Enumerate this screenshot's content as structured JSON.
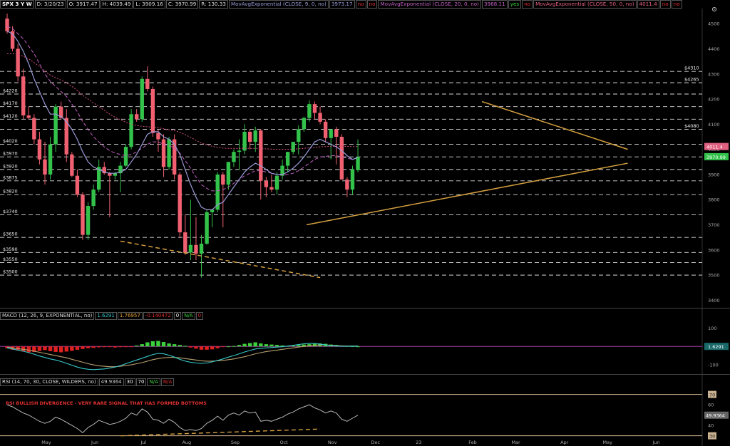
{
  "header": {
    "symbol": "SPX 3 Y W",
    "date": "D: 3/20/23",
    "open": "O: 3917.47",
    "high": "H: 4039.49",
    "low": "L: 3909.16",
    "close": "C: 3970.99",
    "range": "R: 130.33",
    "study_items": [
      {
        "label": "MovAvgExponential (CLOSE, 9, 0, no)",
        "value": "3973.17",
        "a": "no",
        "b": "no",
        "color": "#9a9ad8"
      },
      {
        "label": "MovAvgExponential (CLOSE, 20, 0, no)",
        "value": "3968.11",
        "a": "yes",
        "b": "no",
        "color": "#c060c0"
      },
      {
        "label": "MovAvgExponential (CLOSE, 50, 0, no)",
        "value": "4011.4",
        "a": "no",
        "b": "no",
        "color": "#e06080"
      }
    ]
  },
  "macd_header": {
    "label": "MACD (12, 26, 9, EXPONENTIAL, no)",
    "values": [
      "1.6291",
      "1.76957",
      "-0.140472",
      "0",
      "N/A",
      "0"
    ],
    "colors": [
      "#37c8c8",
      "#e8a838",
      "#e03030",
      "#ffffff",
      "#3cd03c",
      "#e03030"
    ]
  },
  "rsi_header": {
    "label": "RSI (14, 70, 30, CLOSE, WILDERS, no)",
    "values": [
      "49.9364",
      "30",
      "70",
      "N/A",
      "N/A"
    ],
    "colors": [
      "#cccccc",
      "#ffffff",
      "#ffffff",
      "#3cd03c",
      "#e03030"
    ]
  },
  "annotations": {
    "rsi_note": "RSI BULLISH DIVERGENCE - VERY RARE SIGNAL THAT HAS FORMED BOTTOMS"
  },
  "colors": {
    "up": "#33c24a",
    "down": "#f06070",
    "ema9": "#9a9ad8",
    "ema20": "#c060c0",
    "ema50": "#d05080",
    "trend": "#d4a040",
    "macd": "#37c8c8",
    "signal": "#b8a070"
  },
  "chart_data": [
    {
      "type": "candlestick",
      "title": "SPX 3 Y W",
      "ylim": [
        3370,
        4560
      ],
      "y_ticks": [
        3400,
        3500,
        3600,
        3700,
        3800,
        3900,
        4000,
        4100,
        4200,
        4300,
        4400,
        4500
      ],
      "x_tick_labels": [
        {
          "label": "May",
          "i": 0
        },
        {
          "label": "Jun",
          "i": 9
        },
        {
          "label": "Jul",
          "i": 18
        },
        {
          "label": "Aug",
          "i": 26
        },
        {
          "label": "Sep",
          "i": 35
        },
        {
          "label": "Oct",
          "i": 44
        },
        {
          "label": "Nov",
          "i": 53
        },
        {
          "label": "Dec",
          "i": 61
        },
        {
          "label": "23",
          "i": 69
        },
        {
          "label": "Feb",
          "i": 79
        },
        {
          "label": "Mar",
          "i": 87
        },
        {
          "label": "Apr",
          "i": 96
        },
        {
          "label": "May",
          "i": 104
        },
        {
          "label": "Jun",
          "i": 113
        },
        {
          "label": "Jul",
          "i": 122
        }
      ],
      "levels": [
        {
          "label": "$4310",
          "y": 4310,
          "side": "right"
        },
        {
          "label": "$4265",
          "y": 4265,
          "side": "right"
        },
        {
          "label": "$4220",
          "y": 4220,
          "side": "left"
        },
        {
          "label": "$4170",
          "y": 4170,
          "side": "left"
        },
        {
          "label": "$4120",
          "y": 4120,
          "side": "left"
        },
        {
          "label": "$4080",
          "y": 4080,
          "side": "right"
        },
        {
          "label": "$4020",
          "y": 4020,
          "side": "left"
        },
        {
          "label": "$3970",
          "y": 3970,
          "side": "left"
        },
        {
          "label": "$3920",
          "y": 3920,
          "side": "left"
        },
        {
          "label": "$3875",
          "y": 3875,
          "side": "left"
        },
        {
          "label": "$3820",
          "y": 3820,
          "side": "left"
        },
        {
          "label": "$3740",
          "y": 3740,
          "side": "left"
        },
        {
          "label": "$3650",
          "y": 3650,
          "side": "left"
        },
        {
          "label": "$3590",
          "y": 3590,
          "side": "left"
        },
        {
          "label": "$3550",
          "y": 3550,
          "side": "left"
        },
        {
          "label": "$3500",
          "y": 3500,
          "side": "left"
        }
      ],
      "price_badges": [
        {
          "label": "4011.4",
          "y": 4011.4,
          "color": "#e06080"
        },
        {
          "label": "3970.99",
          "y": 3970.99,
          "color": "#33c24a"
        }
      ],
      "candles": [
        [
          4520,
          4540,
          4460,
          4470
        ],
        [
          4470,
          4490,
          4390,
          4400
        ],
        [
          4400,
          4420,
          4270,
          4290
        ],
        [
          4290,
          4320,
          4120,
          4135
        ],
        [
          4135,
          4170,
          4120,
          4125
        ],
        [
          4125,
          4140,
          4020,
          4040
        ],
        [
          4040,
          4070,
          3940,
          3960
        ],
        [
          3960,
          4030,
          3860,
          3900
        ],
        [
          3900,
          4050,
          3880,
          4020
        ],
        [
          4020,
          4180,
          3990,
          4170
        ],
        [
          4170,
          4190,
          4120,
          4125
        ],
        [
          4125,
          4160,
          3950,
          3980
        ],
        [
          3980,
          3990,
          3890,
          3895
        ],
        [
          3895,
          3920,
          3810,
          3820
        ],
        [
          3820,
          3830,
          3640,
          3660
        ],
        [
          3660,
          3790,
          3640,
          3775
        ],
        [
          3775,
          3860,
          3760,
          3840
        ],
        [
          3840,
          3960,
          3830,
          3930
        ],
        [
          3930,
          3950,
          3900,
          3905
        ],
        [
          3905,
          3910,
          3730,
          3895
        ],
        [
          3895,
          3910,
          3880,
          3905
        ],
        [
          3905,
          3950,
          3830,
          3935
        ],
        [
          3935,
          4020,
          3930,
          4010
        ],
        [
          4010,
          4160,
          4000,
          4140
        ],
        [
          4140,
          4160,
          4110,
          4120
        ],
        [
          4120,
          4290,
          4110,
          4280
        ],
        [
          4280,
          4330,
          4230,
          4240
        ],
        [
          4240,
          4250,
          4050,
          4065
        ],
        [
          4065,
          4080,
          3990,
          4040
        ],
        [
          4040,
          4060,
          3890,
          3930
        ],
        [
          3930,
          4050,
          3920,
          4040
        ],
        [
          4040,
          4060,
          3880,
          3900
        ],
        [
          3900,
          3910,
          3650,
          3670
        ],
        [
          3670,
          3740,
          3580,
          3590
        ],
        [
          3590,
          3800,
          3560,
          3620
        ],
        [
          3620,
          3730,
          3560,
          3585
        ],
        [
          3585,
          3660,
          3490,
          3625
        ],
        [
          3625,
          3760,
          3620,
          3750
        ],
        [
          3750,
          3760,
          3690,
          3760
        ],
        [
          3760,
          3910,
          3750,
          3900
        ],
        [
          3900,
          3910,
          3690,
          3860
        ],
        [
          3860,
          3950,
          3840,
          3950
        ],
        [
          3950,
          4000,
          3930,
          3990
        ],
        [
          3990,
          4040,
          3920,
          3995
        ],
        [
          3995,
          4100,
          3980,
          4070
        ],
        [
          4070,
          4080,
          4000,
          4030
        ],
        [
          4030,
          4090,
          3990,
          4075
        ],
        [
          4075,
          4080,
          3800,
          3875
        ],
        [
          3875,
          3890,
          3810,
          3850
        ],
        [
          3850,
          3900,
          3830,
          3840
        ],
        [
          3840,
          3910,
          3820,
          3895
        ],
        [
          3895,
          3960,
          3880,
          3935
        ],
        [
          3935,
          3990,
          3910,
          3990
        ],
        [
          3990,
          4030,
          3980,
          4030
        ],
        [
          4030,
          4095,
          3980,
          4080
        ],
        [
          4080,
          4130,
          4070,
          4125
        ],
        [
          4125,
          4195,
          4110,
          4180
        ],
        [
          4180,
          4190,
          4120,
          4145
        ],
        [
          4145,
          4170,
          4100,
          4110
        ],
        [
          4110,
          4120,
          4030,
          4045
        ],
        [
          4045,
          4060,
          3960,
          4080
        ],
        [
          4080,
          4090,
          3940,
          4050
        ],
        [
          4050,
          4060,
          3900,
          3880
        ],
        [
          3880,
          3890,
          3810,
          3840
        ],
        [
          3840,
          3935,
          3820,
          3920
        ],
        [
          3917.47,
          4039.49,
          3909.16,
          3970.99
        ]
      ],
      "ema9": [
        4470,
        4460,
        4430,
        4390,
        4340,
        4280,
        4230,
        4180,
        4140,
        4140,
        4130,
        4110,
        4080,
        4040,
        3990,
        3950,
        3930,
        3920,
        3910,
        3905,
        3905,
        3910,
        3920,
        3950,
        3980,
        4020,
        4060,
        4070,
        4070,
        4050,
        4040,
        4020,
        3980,
        3920,
        3860,
        3810,
        3770,
        3760,
        3760,
        3780,
        3790,
        3820,
        3850,
        3880,
        3910,
        3930,
        3945,
        3935,
        3920,
        3905,
        3900,
        3900,
        3910,
        3925,
        3945,
        3970,
        4000,
        4030,
        4040,
        4030,
        4020,
        4010,
        3995,
        3975,
        3960,
        3968
      ],
      "ema20": [
        4490,
        4480,
        4460,
        4440,
        4410,
        4380,
        4340,
        4300,
        4270,
        4250,
        4230,
        4210,
        4180,
        4150,
        4110,
        4080,
        4050,
        4030,
        4010,
        3995,
        3985,
        3980,
        3975,
        3980,
        3990,
        4005,
        4020,
        4030,
        4030,
        4020,
        4015,
        4005,
        3985,
        3955,
        3925,
        3890,
        3860,
        3845,
        3835,
        3835,
        3840,
        3850,
        3865,
        3880,
        3895,
        3905,
        3915,
        3915,
        3910,
        3905,
        3900,
        3898,
        3900,
        3905,
        3915,
        3930,
        3945,
        3960,
        3970,
        3972,
        3975,
        3975,
        3970,
        3965,
        3960,
        3968
      ],
      "ema50": [
        4380,
        4380,
        4378,
        4370,
        4360,
        4345,
        4330,
        4310,
        4295,
        4285,
        4275,
        4265,
        4250,
        4235,
        4215,
        4200,
        4185,
        4170,
        4155,
        4140,
        4128,
        4118,
        4108,
        4100,
        4095,
        4092,
        4090,
        4088,
        4086,
        4082,
        4078,
        4074,
        4068,
        4058,
        4048,
        4036,
        4025,
        4018,
        4012,
        4008,
        4005,
        4004,
        4004,
        4004,
        4004,
        4004,
        4004,
        4003,
        4002,
        4001,
        4000,
        4000,
        4000,
        4001,
        4002,
        4004,
        4006,
        4008,
        4010,
        4011,
        4012,
        4012,
        4012,
        4012,
        4011,
        4011.4
      ],
      "trendlines": [
        {
          "from": [
            55.5,
            3700
          ],
          "to": [
            115,
            3945
          ],
          "dash": false
        },
        {
          "from": [
            88,
            4190
          ],
          "to": [
            115,
            4000
          ],
          "dash": false
        },
        {
          "from": [
            21,
            3635
          ],
          "to": [
            58,
            3490
          ],
          "dash": true
        }
      ]
    },
    {
      "type": "bar",
      "title": "MACD (12, 26, 9, EXPONENTIAL, no)",
      "ylim": [
        -150,
        140
      ],
      "y_ticks": [
        100,
        -100
      ],
      "badge": {
        "label": "1.6291",
        "y": 0
      },
      "histogram": [
        -10,
        -18,
        -22,
        -28,
        -32,
        -30,
        -25,
        -20,
        -26,
        -30,
        -32,
        -28,
        -24,
        -18,
        -14,
        -10,
        -8,
        -5,
        -4,
        -4,
        -6,
        -4,
        -2,
        -1,
        5,
        12,
        22,
        28,
        30,
        24,
        16,
        12,
        8,
        3,
        -6,
        -12,
        -18,
        -18,
        -16,
        -10,
        -2,
        0,
        2,
        8,
        14,
        18,
        22,
        16,
        12,
        10,
        8,
        5,
        3,
        5,
        7,
        10,
        12,
        14,
        16,
        14,
        10,
        8,
        4,
        2,
        1,
        0
      ],
      "macd": [
        -8,
        -14,
        -20,
        -26,
        -34,
        -42,
        -52,
        -60,
        -68,
        -74,
        -82,
        -92,
        -102,
        -112,
        -120,
        -124,
        -126,
        -124,
        -122,
        -118,
        -112,
        -104,
        -94,
        -84,
        -74,
        -64,
        -54,
        -44,
        -38,
        -40,
        -48,
        -58,
        -70,
        -80,
        -86,
        -90,
        -92,
        -90,
        -84,
        -76,
        -68,
        -58,
        -50,
        -40,
        -30,
        -22,
        -14,
        -10,
        -8,
        -6,
        -4,
        -2,
        2,
        6,
        10,
        14,
        16,
        16,
        12,
        8,
        4,
        2,
        1,
        1,
        1,
        1.6291
      ],
      "signal": [
        -4,
        -8,
        -12,
        -16,
        -20,
        -26,
        -32,
        -38,
        -44,
        -50,
        -56,
        -62,
        -70,
        -78,
        -86,
        -94,
        -100,
        -105,
        -108,
        -110,
        -110,
        -108,
        -104,
        -100,
        -94,
        -88,
        -80,
        -72,
        -66,
        -62,
        -60,
        -60,
        -62,
        -66,
        -70,
        -74,
        -78,
        -80,
        -80,
        -78,
        -76,
        -72,
        -68,
        -62,
        -56,
        -48,
        -40,
        -34,
        -28,
        -24,
        -20,
        -16,
        -12,
        -8,
        -4,
        0,
        3,
        6,
        8,
        8,
        6,
        4,
        3,
        2,
        2,
        1.76957
      ]
    },
    {
      "type": "line",
      "title": "RSI (14, 70, 30, CLOSE, WILDERS, no)",
      "ylim": [
        27,
        78
      ],
      "y_ticks": [
        60,
        40
      ],
      "levels": [
        {
          "label": "70",
          "y": 70
        },
        {
          "label": "30",
          "y": 30
        }
      ],
      "badge": {
        "label": "49.9364",
        "y": 49.9364
      },
      "values": [
        60,
        58,
        55,
        52,
        50,
        47,
        44,
        42,
        44,
        48,
        46,
        43,
        40,
        37,
        33,
        38,
        41,
        45,
        43,
        41,
        42,
        44,
        47,
        52,
        50,
        56,
        53,
        46,
        45,
        42,
        46,
        43,
        38,
        35,
        36,
        35,
        37,
        42,
        45,
        49,
        45,
        50,
        52,
        50,
        54,
        52,
        53,
        44,
        45,
        44,
        46,
        48,
        51,
        53,
        56,
        58,
        60,
        57,
        55,
        52,
        54,
        52,
        46,
        44,
        47,
        49.9364
      ],
      "divergence_line": {
        "from": [
          21,
          30
        ],
        "to": [
          58,
          36.5
        ]
      }
    }
  ]
}
